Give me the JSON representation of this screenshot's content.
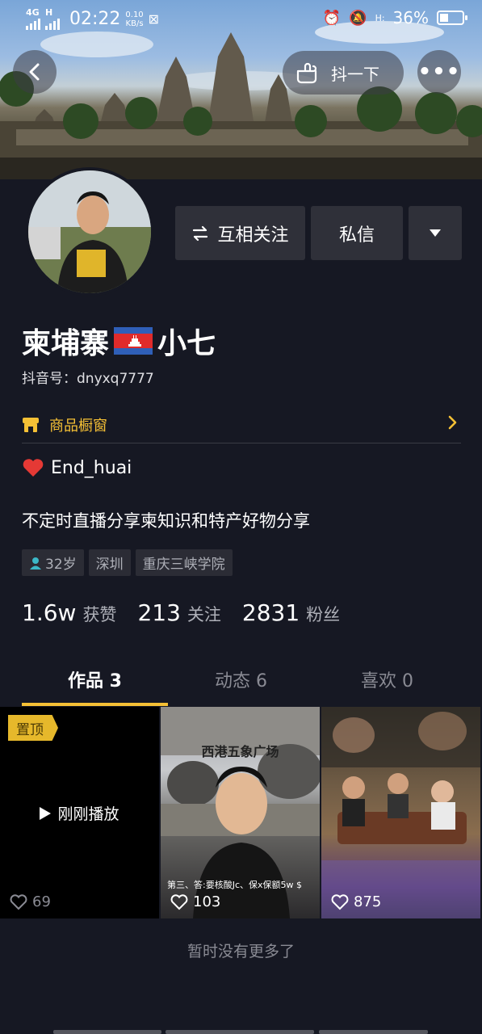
{
  "status_bar": {
    "network": "4G",
    "network2": "H",
    "time": "02:22",
    "speed_value": "0.10",
    "speed_unit": "KB/s",
    "battery": "36%"
  },
  "header": {
    "pat_label": "抖一下"
  },
  "profile": {
    "follow_each_label": "互相关注",
    "message_label": "私信",
    "name_part1": "柬埔寨",
    "name_part2": "小七",
    "douyin_id": "抖音号：dnyxq7777",
    "shop_label": "商品橱窗",
    "signature_line1": "End_huai",
    "signature_line2": "不定时直播分享柬知识和特产好物分享",
    "tags": [
      "32岁",
      "深圳",
      "重庆三峡学院"
    ],
    "stats": [
      {
        "num": "1.6w",
        "label": "获赞"
      },
      {
        "num": "213",
        "label": "关注"
      },
      {
        "num": "2831",
        "label": "粉丝"
      }
    ]
  },
  "tabs": [
    {
      "label": "作品 3"
    },
    {
      "label": "动态 6"
    },
    {
      "label": "喜欢 0"
    }
  ],
  "videos": [
    {
      "pinned": "置顶",
      "overlay": "刚刚播放",
      "likes": "69"
    },
    {
      "title": "西港五象广场",
      "caption": "第三、答:要核酸Jc、保x保额5w $",
      "likes": "103"
    },
    {
      "likes": "875"
    }
  ],
  "footer": {
    "no_more": "暂时没有更多了"
  },
  "colors": {
    "background": "#161823",
    "accent": "#f5c035",
    "button": "#2f3039",
    "muted_text": "#aeb0b8"
  }
}
